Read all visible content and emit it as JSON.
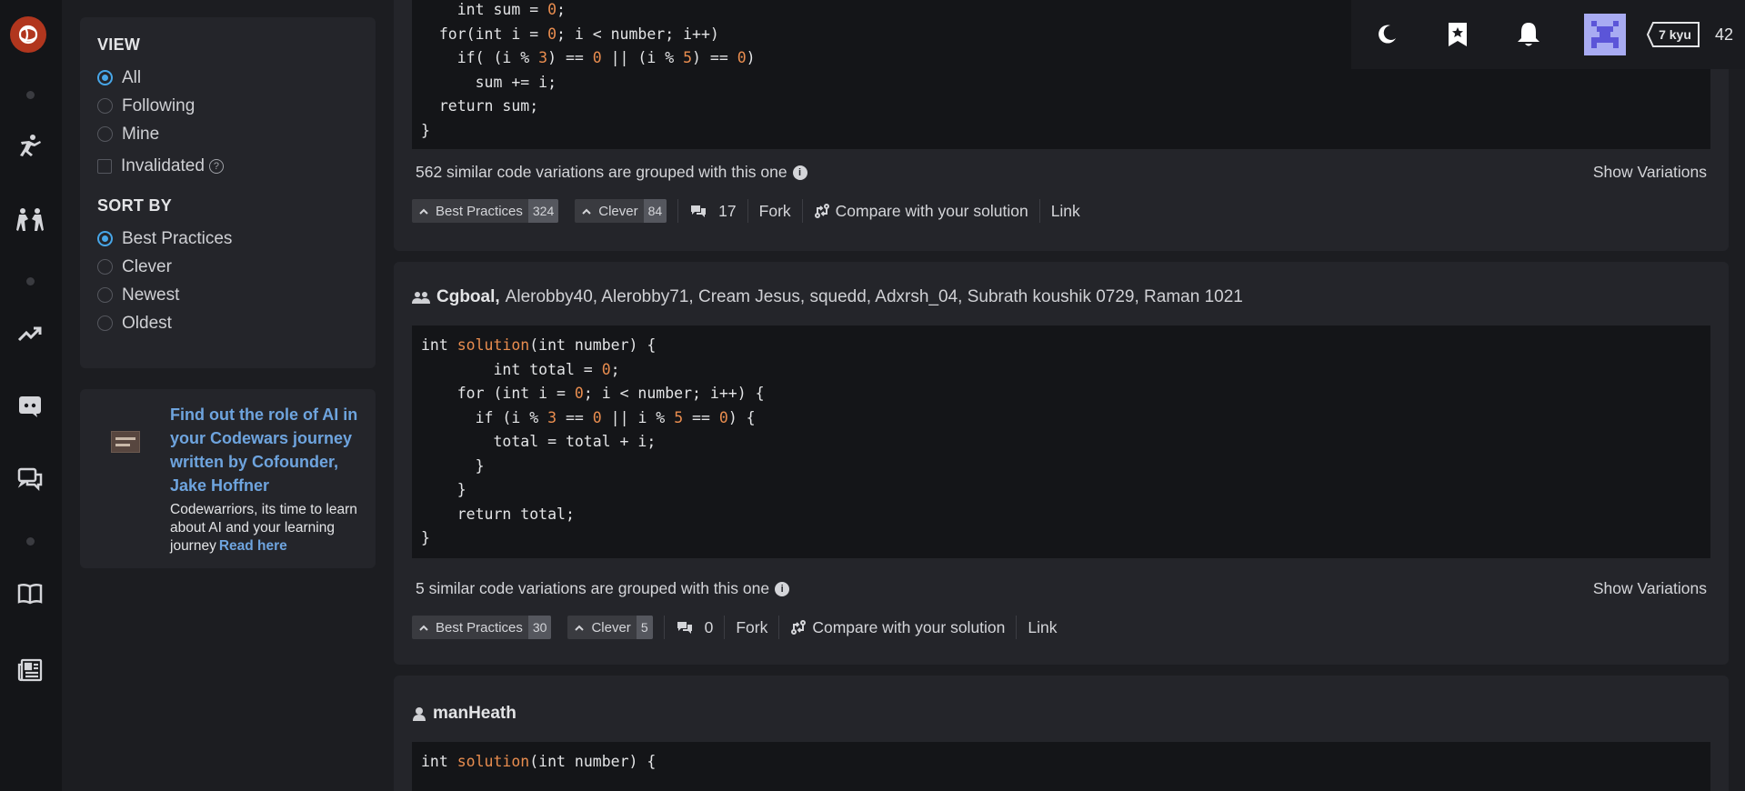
{
  "filters": {
    "view_heading": "VIEW",
    "view_options": [
      {
        "label": "All",
        "selected": true
      },
      {
        "label": "Following",
        "selected": false
      },
      {
        "label": "Mine",
        "selected": false
      }
    ],
    "invalidated_label": "Invalidated",
    "sort_heading": "SORT BY",
    "sort_options": [
      {
        "label": "Best Practices",
        "selected": true
      },
      {
        "label": "Clever",
        "selected": false
      },
      {
        "label": "Newest",
        "selected": false
      },
      {
        "label": "Oldest",
        "selected": false
      }
    ]
  },
  "promo": {
    "title": "Find out the role of AI in your Codewars journey written by Cofounder, Jake Hoffner",
    "text": "Codewarriors, its time to learn about AI and your learning journey",
    "link": "Read here"
  },
  "topbar": {
    "rank": "7 kyu",
    "honor": "42"
  },
  "solutions": [
    {
      "variations_text": "562 similar code variations are grouped with this one",
      "show_variations": "Show Variations",
      "best_practices_label": "Best Practices",
      "best_practices_count": "324",
      "clever_label": "Clever",
      "clever_count": "84",
      "comments": "17",
      "fork": "Fork",
      "compare": "Compare with your solution",
      "link": "Link"
    },
    {
      "main_author": "Cgboal,",
      "other_authors": "Alerobby40, Alerobby71, Cream Jesus, squedd, Adxrsh_04, Subrath koushik 0729, Raman 1021",
      "variations_text": "5 similar code variations are grouped with this one",
      "show_variations": "Show Variations",
      "best_practices_label": "Best Practices",
      "best_practices_count": "30",
      "clever_label": "Clever",
      "clever_count": "5",
      "comments": "0",
      "fork": "Fork",
      "compare": "Compare with your solution",
      "link": "Link"
    },
    {
      "main_author": "manHeath"
    }
  ],
  "code": {
    "s1": {
      "l1_a": "    int sum = ",
      "l1_n": "0",
      "l1_b": ";",
      "l2_a": "  for(int i = ",
      "l2_n": "0",
      "l2_b": "; i < number; i++)",
      "l3_a": "    if( (i % ",
      "l3_n1": "3",
      "l3_b": ") == ",
      "l3_n2": "0",
      "l3_c": " || (i % ",
      "l3_n3": "5",
      "l3_d": ") == ",
      "l3_n4": "0",
      "l3_e": ")",
      "l4": "      sum += i;",
      "l5": "  return sum;",
      "l6": "}"
    },
    "s2": {
      "l1_a": "int ",
      "l1_fn": "solution",
      "l1_b": "(int number) {",
      "l2_a": "        int total = ",
      "l2_n": "0",
      "l2_b": ";",
      "l3_a": "    for (int i = ",
      "l3_n": "0",
      "l3_b": "; i < number; i++) {",
      "l4_a": "      if (i % ",
      "l4_n1": "3",
      "l4_b": " == ",
      "l4_n2": "0",
      "l4_c": " || i % ",
      "l4_n3": "5",
      "l4_d": " == ",
      "l4_n4": "0",
      "l4_e": ") {",
      "l5": "        total = total + i;",
      "l6": "      }",
      "l7": "    }",
      "l8": "    return total;",
      "l9": "}"
    },
    "s3": {
      "l1_a": "int ",
      "l1_fn": "solution",
      "l1_b": "(int number) {"
    }
  }
}
